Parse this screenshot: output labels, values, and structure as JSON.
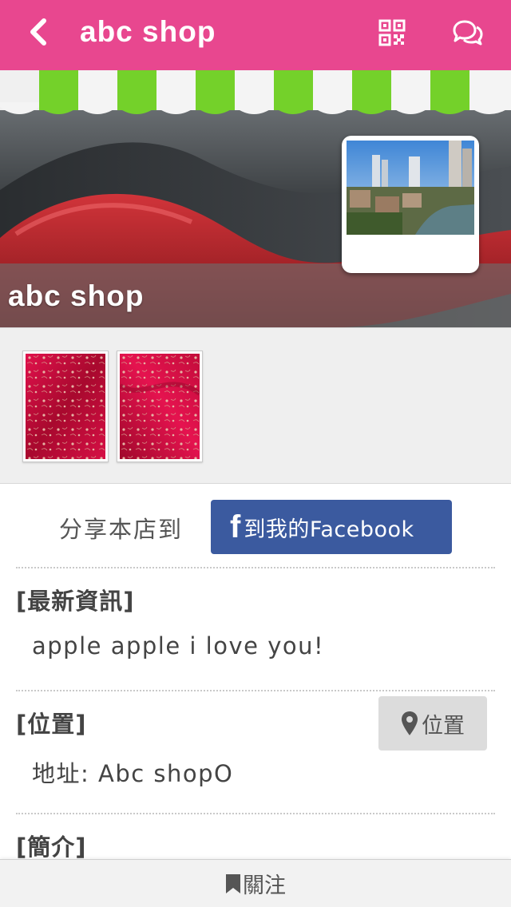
{
  "header": {
    "title": "abc shop",
    "back_icon": "chevron-left-icon",
    "qr_icon": "qr-code-icon",
    "chat_icon": "chat-bubbles-icon",
    "bg_color": "#e8478f"
  },
  "banner": {
    "shop_name": "abc shop"
  },
  "share": {
    "label": "分享本店到",
    "facebook_icon_letter": "f",
    "facebook_button": "到我的Facebook",
    "button_color": "#3b5a9f"
  },
  "news": {
    "title": "[最新資訊]",
    "body": "apple apple i love you!"
  },
  "location": {
    "title": "[位置]",
    "address": "地址: Abc shopO",
    "button_label": "位置",
    "button_icon": "map-pin-icon"
  },
  "intro": {
    "title": "[簡介]"
  },
  "footer": {
    "follow_label": "關注",
    "follow_icon": "bookmark-icon"
  }
}
